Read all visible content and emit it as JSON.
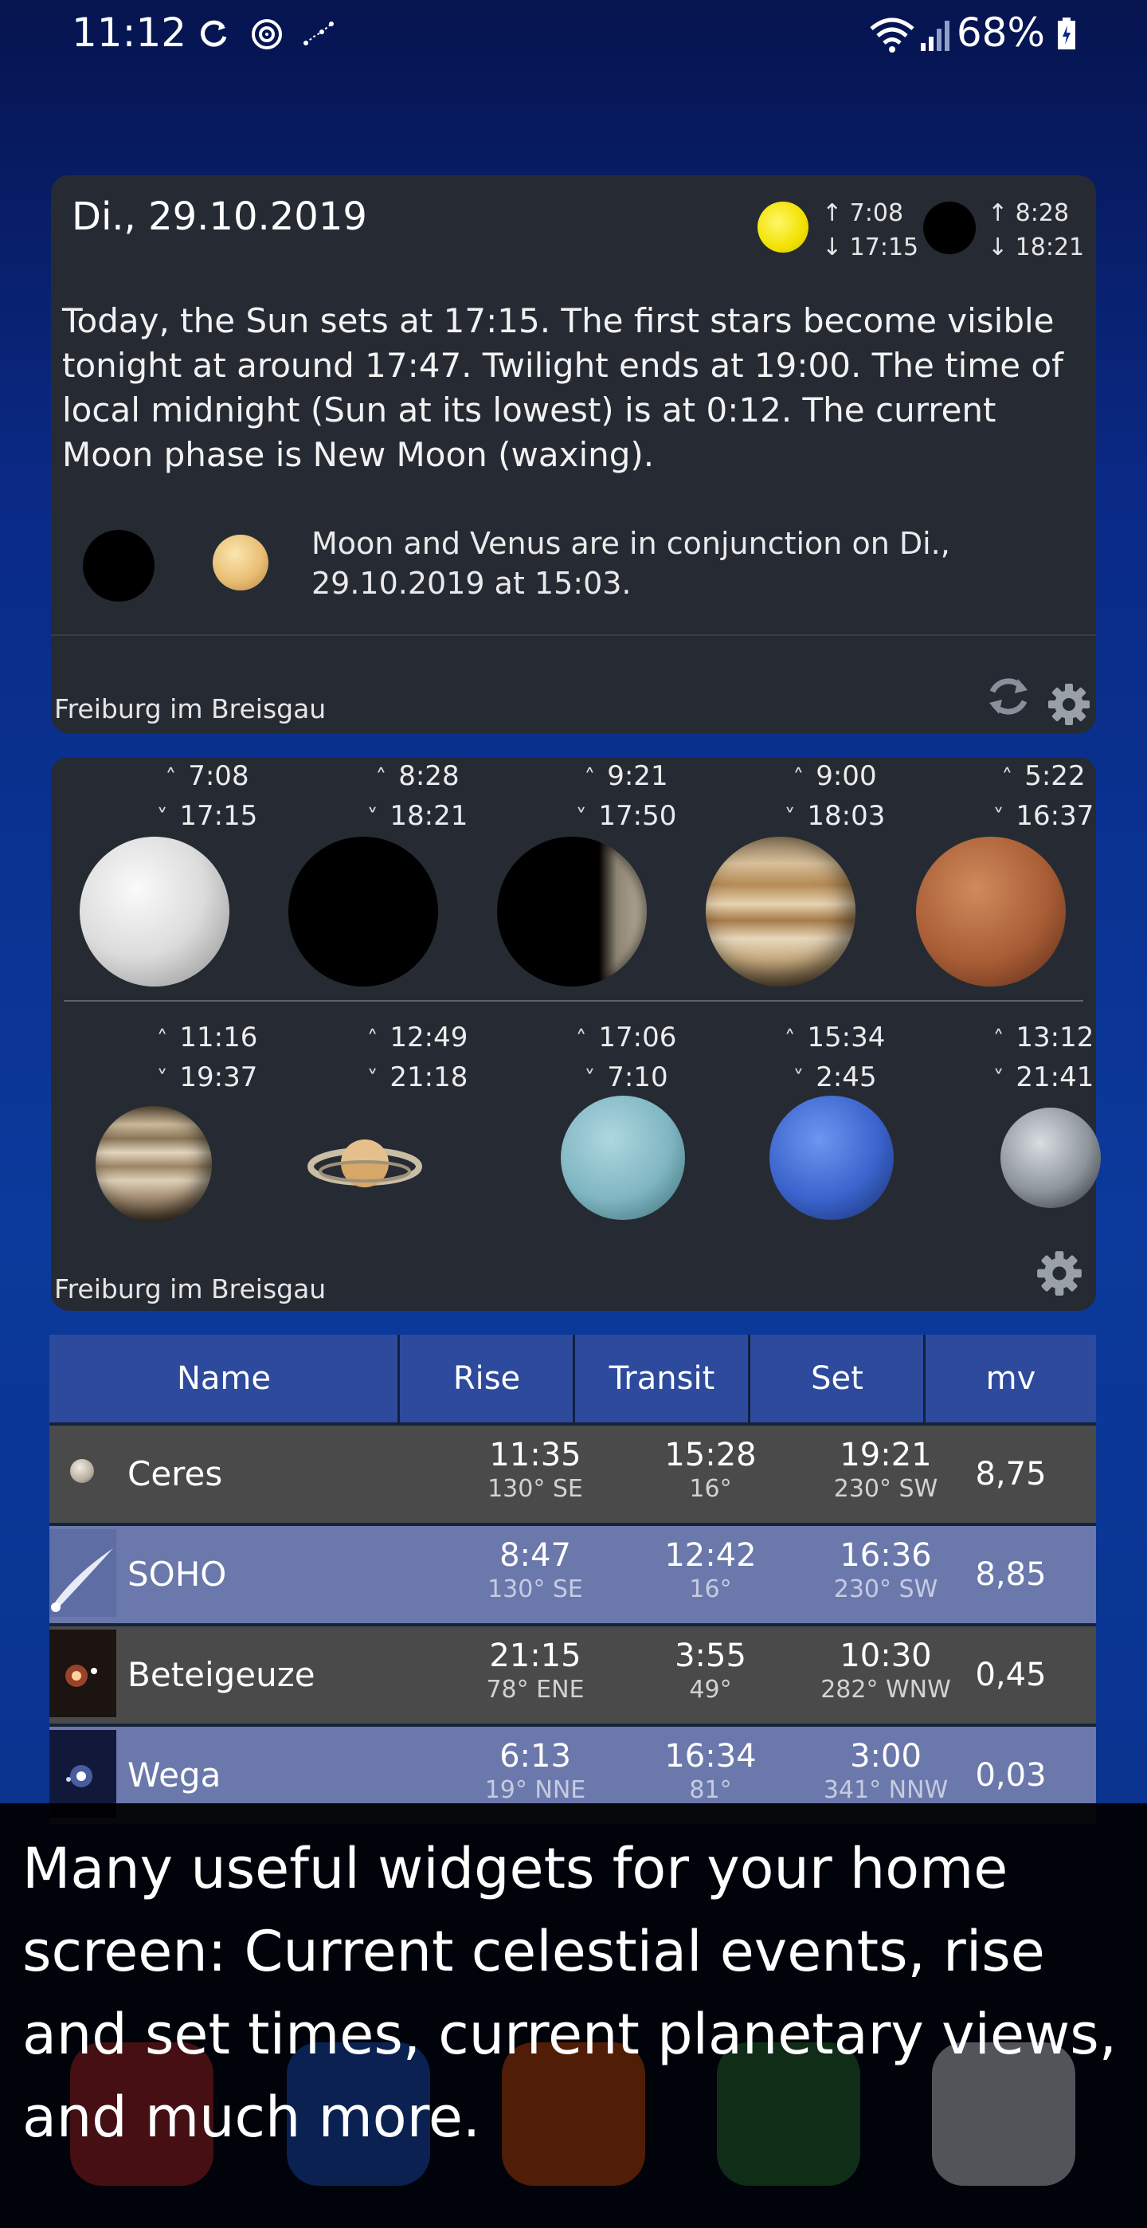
{
  "status_bar": {
    "time": "11:12",
    "battery": "68%"
  },
  "events_widget": {
    "date": "Di., 29.10.2019",
    "sun": {
      "rise": "↑ 7:08",
      "set": "↓ 17:15"
    },
    "moon": {
      "rise": "↑ 8:28",
      "set": "↓ 18:21"
    },
    "description": "Today, the Sun sets at 17:15. The first stars become visible tonight at around 17:47. Twilight ends at 19:00. The time of local midnight (Sun at its lowest) is at 0:12. The current Moon phase is New Moon (waxing).",
    "conjunction": "Moon and Venus are in conjunction on Di., 29.10.2019 at 15:03.",
    "location": "Freiburg im Breisgau"
  },
  "planets_widget": {
    "row1": [
      {
        "rise": "7:08",
        "set": "17:15"
      },
      {
        "rise": "8:28",
        "set": "18:21"
      },
      {
        "rise": "9:21",
        "set": "17:50"
      },
      {
        "rise": "9:00",
        "set": "18:03"
      },
      {
        "rise": "5:22",
        "set": "16:37"
      }
    ],
    "row2": [
      {
        "rise": "11:16",
        "set": "19:37"
      },
      {
        "rise": "12:49",
        "set": "21:18"
      },
      {
        "rise": "17:06",
        "set": "7:10"
      },
      {
        "rise": "15:34",
        "set": "2:45"
      },
      {
        "rise": "13:12",
        "set": "21:41"
      }
    ],
    "location": "Freiburg im Breisgau"
  },
  "objects_table": {
    "headers": [
      "Name",
      "Rise",
      "Transit",
      "Set",
      "mv"
    ],
    "rows": [
      {
        "name": "Ceres",
        "rise": "11:35",
        "rise_dir": "130° SE",
        "transit": "15:28",
        "transit_alt": "16°",
        "set": "19:21",
        "set_dir": "230° SW",
        "mv": "8,75"
      },
      {
        "name": "SOHO",
        "rise": "8:47",
        "rise_dir": "130° SE",
        "transit": "12:42",
        "transit_alt": "16°",
        "set": "16:36",
        "set_dir": "230° SW",
        "mv": "8,85"
      },
      {
        "name": "Beteigeuze",
        "rise": "21:15",
        "rise_dir": "78° ENE",
        "transit": "3:55",
        "transit_alt": "49°",
        "set": "10:30",
        "set_dir": "282° WNW",
        "mv": "0,45"
      },
      {
        "name": "Wega",
        "rise": "6:13",
        "rise_dir": "19° NNE",
        "transit": "16:34",
        "transit_alt": "81°",
        "set": "3:00",
        "set_dir": "341° NNW",
        "mv": "0,03"
      }
    ]
  },
  "caption": "Many useful widgets for your home screen: Current celestial events, rise and set times, current planetary views, and much more."
}
